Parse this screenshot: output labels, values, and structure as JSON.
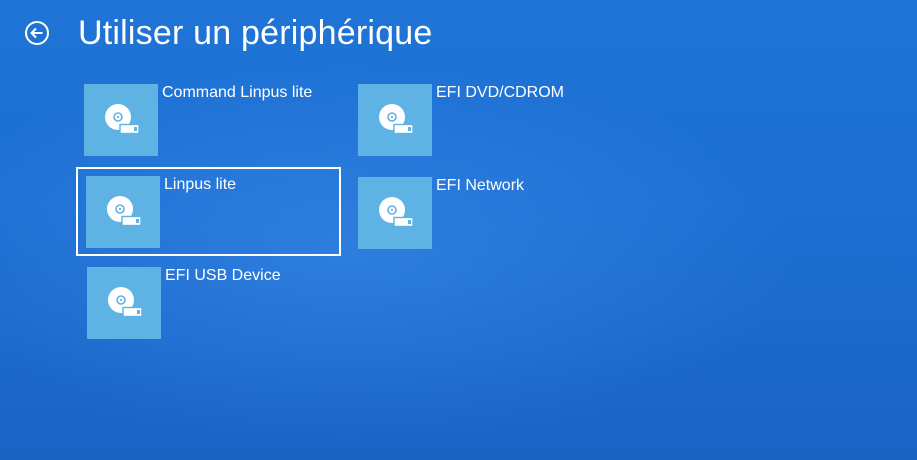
{
  "header": {
    "title": "Utiliser un périphérique",
    "back_icon": "back-arrow-circle-icon"
  },
  "colors": {
    "background": "#1d6fd2",
    "tile": "#5fb2e4",
    "text": "#ffffff"
  },
  "devices": [
    {
      "label": "Command Linpus lite",
      "icon": "disk-drive-icon",
      "focused": false
    },
    {
      "label": "EFI DVD/CDROM",
      "icon": "disk-drive-icon",
      "focused": false
    },
    {
      "label": "Linpus lite",
      "icon": "disk-drive-icon",
      "focused": true
    },
    {
      "label": "EFI Network",
      "icon": "disk-drive-icon",
      "focused": false
    },
    {
      "label": "EFI USB Device",
      "icon": "disk-drive-icon",
      "focused": false
    }
  ]
}
